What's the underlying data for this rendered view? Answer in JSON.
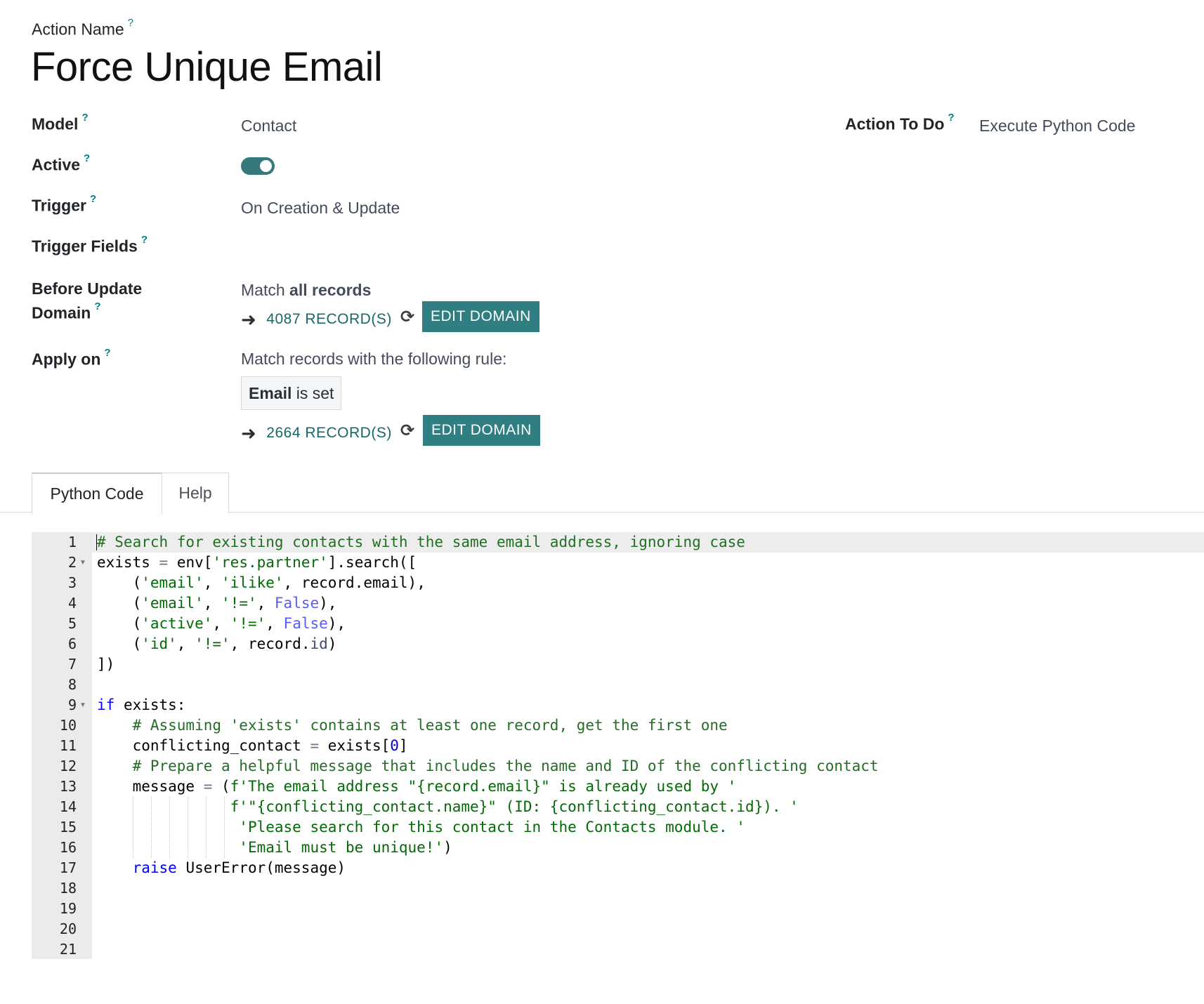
{
  "header": {
    "action_name_label": "Action Name",
    "title": "Force Unique Email"
  },
  "help_marker": "?",
  "fields": {
    "model": {
      "label": "Model",
      "value": "Contact"
    },
    "action_to_do": {
      "label": "Action To Do",
      "value": "Execute Python Code"
    },
    "active": {
      "label": "Active",
      "value": true
    },
    "trigger": {
      "label": "Trigger",
      "value": "On Creation & Update"
    },
    "trigger_fields": {
      "label": "Trigger Fields",
      "value": ""
    },
    "before_update_domain": {
      "label_line1": "Before Update",
      "label_line2": "Domain",
      "match_prefix": "Match",
      "match_bold": "all records",
      "records": "4087 RECORD(S)",
      "edit_label": "EDIT DOMAIN"
    },
    "apply_on": {
      "label": "Apply on",
      "match_text": "Match records with the following rule:",
      "rule_field": "Email",
      "rule_operator": "is set",
      "records": "2664 RECORD(S)",
      "edit_label": "EDIT DOMAIN"
    }
  },
  "tabs": [
    {
      "label": "Python Code",
      "active": true
    },
    {
      "label": "Help",
      "active": false
    }
  ],
  "colors": {
    "accent": "#017e84",
    "button": "#2f7f82",
    "toggle_on": "#35797d"
  },
  "editor": {
    "line_numbers": [
      "1",
      "2",
      "3",
      "4",
      "5",
      "6",
      "7",
      "8",
      "9",
      "10",
      "11",
      "12",
      "13",
      "14",
      "15",
      "16",
      "17",
      "18",
      "19",
      "20",
      "21"
    ],
    "lines": [
      "# Search for existing contacts with the same email address, ignoring case",
      "exists = env['res.partner'].search([",
      "    ('email', 'ilike', record.email),",
      "    ('email', '!=', False),",
      "    ('active', '!=', False),",
      "    ('id', '!=', record.id)",
      "])",
      "",
      "if exists:",
      "    # Assuming 'exists' contains at least one record, get the first one",
      "    conflicting_contact = exists[0]",
      "    # Prepare a helpful message that includes the name and ID of the conflicting contact",
      "    message = (f'The email address \"{record.email}\" is already used by '",
      "               f'\"{conflicting_contact.name}\" (ID: {conflicting_contact.id}). '",
      "                'Please search for this contact in the Contacts module. '",
      "                'Email must be unique!')",
      "    raise UserError(message)",
      "",
      "",
      "",
      ""
    ]
  }
}
